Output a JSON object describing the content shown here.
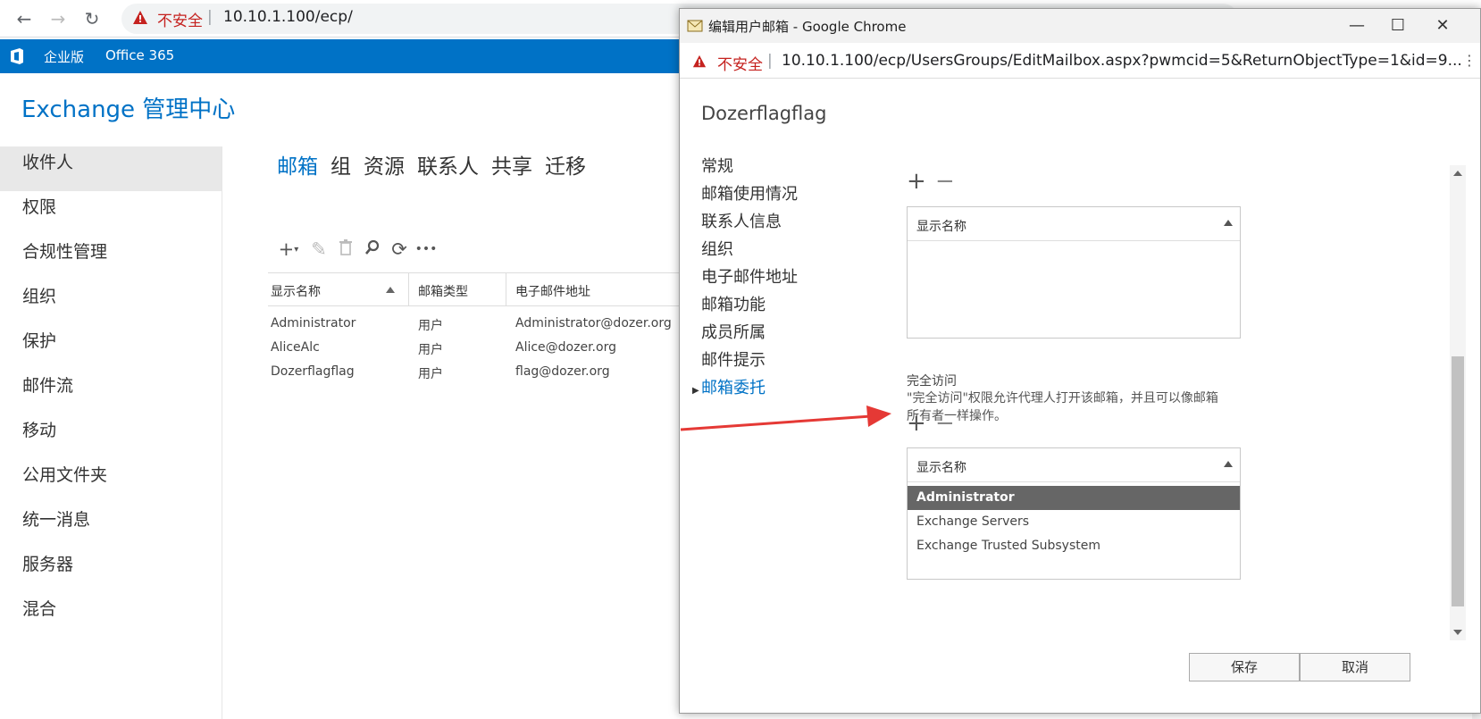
{
  "browser": {
    "insecure_label": "不安全",
    "separator": "|",
    "url": "10.10.1.100/ecp/"
  },
  "o365": {
    "edition": "企业版",
    "product": "Office 365"
  },
  "eac_title": "Exchange 管理中心",
  "leftnav": {
    "items": [
      {
        "label": "收件人"
      },
      {
        "label": "权限"
      },
      {
        "label": "合规性管理"
      },
      {
        "label": "组织"
      },
      {
        "label": "保护"
      },
      {
        "label": "邮件流"
      },
      {
        "label": "移动"
      },
      {
        "label": "公用文件夹"
      },
      {
        "label": "统一消息"
      },
      {
        "label": "服务器"
      },
      {
        "label": "混合"
      }
    ],
    "active_index": 0
  },
  "tabs": [
    {
      "label": "邮箱"
    },
    {
      "label": "组"
    },
    {
      "label": "资源"
    },
    {
      "label": "联系人"
    },
    {
      "label": "共享"
    },
    {
      "label": "迁移"
    }
  ],
  "list_toolbar": {
    "add_icon": "plus-icon",
    "edit_icon": "pencil-icon",
    "delete_icon": "trash-icon",
    "search_icon": "search-icon",
    "refresh_icon": "refresh-icon",
    "more_label": "•••"
  },
  "table": {
    "columns": [
      "显示名称",
      "邮箱类型",
      "电子邮件地址"
    ],
    "rows": [
      [
        "Administrator",
        "用户",
        "Administrator@dozer.org"
      ],
      [
        "AliceAlc",
        "用户",
        "Alice@dozer.org"
      ],
      [
        "Dozerflagflag",
        "用户",
        "flag@dozer.org"
      ]
    ]
  },
  "popup": {
    "title": "编辑用户邮箱 - Google Chrome",
    "insecure_label": "不安全",
    "separator": "|",
    "url": "10.10.1.100/ecp/UsersGroups/EditMailbox.aspx?pwmcid=5&ReturnObjectType=1&id=9...",
    "mailbox_name": "Dozerflagflag",
    "sections": [
      {
        "label": "常规"
      },
      {
        "label": "邮箱使用情况"
      },
      {
        "label": "联系人信息"
      },
      {
        "label": "组织"
      },
      {
        "label": "电子邮件地址"
      },
      {
        "label": "邮箱功能"
      },
      {
        "label": "成员所属"
      },
      {
        "label": "邮件提示"
      },
      {
        "label": "邮箱委托"
      }
    ],
    "active_section_index": 8,
    "plus_label": "+",
    "minus_label": "−",
    "list1": {
      "header": "显示名称",
      "items": []
    },
    "full_access": {
      "title": "完全访问",
      "description": "\"完全访问\"权限允许代理人打开该邮箱，并且可以像邮箱所有者一样操作。"
    },
    "list2": {
      "header": "显示名称",
      "items": [
        "Administrator",
        "Exchange Servers",
        "Exchange Trusted Subsystem"
      ],
      "selected_index": 0
    },
    "save_label": "保存",
    "cancel_label": "取消"
  },
  "colors": {
    "brand_blue": "#0072c6",
    "warning_red": "#c5221f",
    "annotation_arrow": "#e53935"
  }
}
